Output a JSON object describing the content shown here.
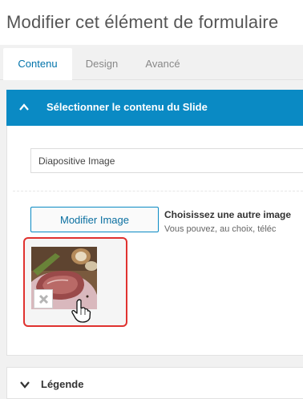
{
  "header": {
    "title": "Modifier cet élément de formulaire"
  },
  "tabs": [
    {
      "label": "Contenu",
      "active": true
    },
    {
      "label": "Design",
      "active": false
    },
    {
      "label": "Avancé",
      "active": false
    }
  ],
  "section": {
    "title": "Sélectionner le contenu du Slide",
    "expanded": true,
    "accent_color": "#0a8ac4",
    "input": {
      "value": "Diapositive Image"
    },
    "image_picker": {
      "button_label": "Modifier Image",
      "heading": "Choisissez une autre image",
      "description": "Vous pouvez, au choix, téléc",
      "remove_icon": "close-icon",
      "highlight_color": "#e0322f"
    }
  },
  "legend": {
    "title": "Légende",
    "expanded": false
  }
}
